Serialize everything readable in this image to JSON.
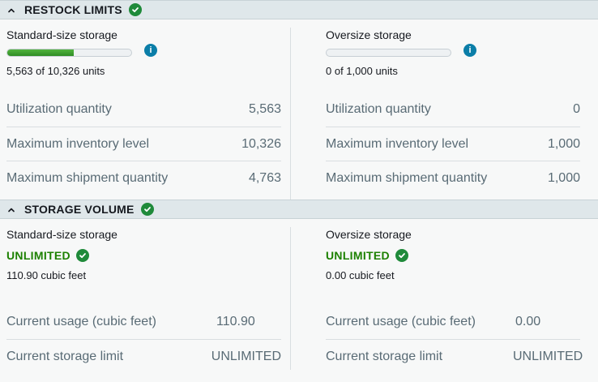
{
  "restock": {
    "title": "RESTOCK LIMITS",
    "standard": {
      "title": "Standard-size storage",
      "units_text": "5,563 of 10,326 units",
      "usage_percent": 53.9,
      "rows": [
        {
          "label": "Utilization quantity",
          "value": "5,563"
        },
        {
          "label": "Maximum inventory level",
          "value": "10,326"
        },
        {
          "label": "Maximum shipment quantity",
          "value": "4,763"
        }
      ]
    },
    "oversize": {
      "title": "Oversize storage",
      "units_text": "0 of 1,000 units",
      "usage_percent": 0,
      "rows": [
        {
          "label": "Utilization quantity",
          "value": "0"
        },
        {
          "label": "Maximum inventory level",
          "value": "1,000"
        },
        {
          "label": "Maximum shipment quantity",
          "value": "1,000"
        }
      ]
    }
  },
  "storage": {
    "title": "STORAGE VOLUME",
    "standard": {
      "title": "Standard-size storage",
      "status": "UNLIMITED",
      "volume_text": "110.90 cubic feet",
      "rows": [
        {
          "label": "Current usage (cubic feet)",
          "value": "110.90"
        },
        {
          "label": "Current storage limit",
          "value": "UNLIMITED"
        }
      ]
    },
    "oversize": {
      "title": "Oversize storage",
      "status": "UNLIMITED",
      "volume_text": "0.00 cubic feet",
      "rows": [
        {
          "label": "Current usage (cubic feet)",
          "value": "0.00"
        },
        {
          "label": "Current storage limit",
          "value": "UNLIMITED"
        }
      ]
    }
  },
  "colors": {
    "header_bg": "#dfe7ea",
    "success_green": "#1d8102",
    "bar_green": "#53b53f",
    "info_blue": "#0b7ea8",
    "label_gray": "#596b75"
  },
  "icons": {
    "collapse": "chevron-up-icon",
    "status_ok": "check-circle-icon",
    "info": "info-icon"
  }
}
